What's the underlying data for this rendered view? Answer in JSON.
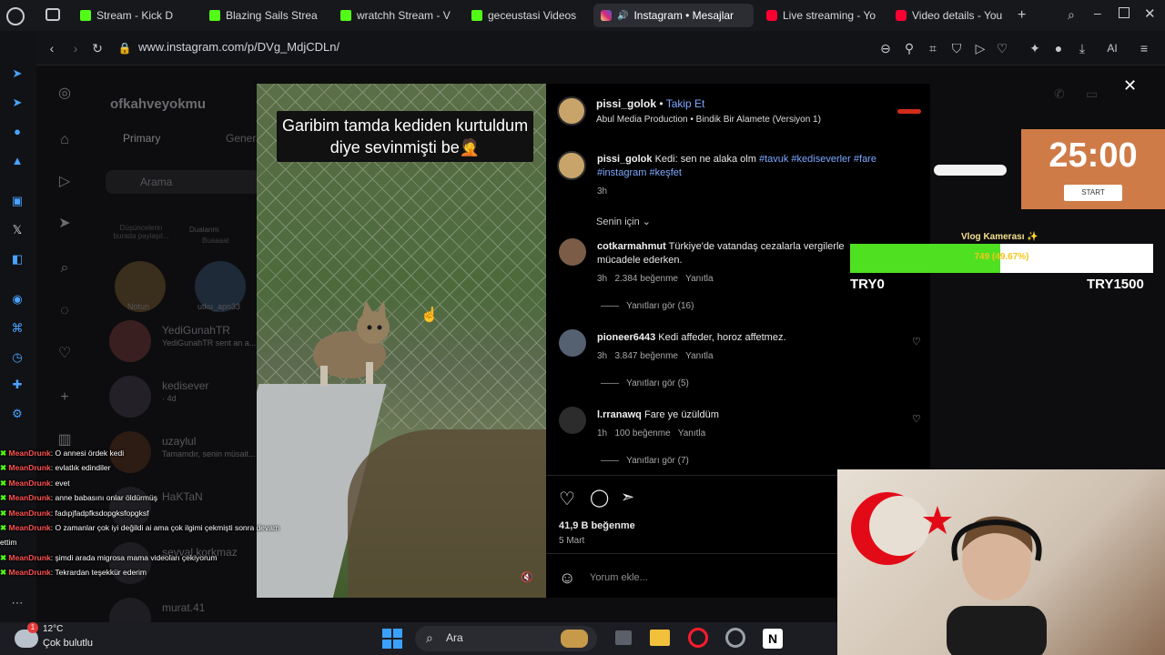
{
  "browser": {
    "tabs": [
      {
        "label": "Stream - Kick D",
        "icon": "kick-icon"
      },
      {
        "label": "Blazing Sails Strea",
        "icon": "kick-icon"
      },
      {
        "label": "wratchh Stream - V",
        "icon": "kick-icon"
      },
      {
        "label": "geceustasi Videos",
        "icon": "kick-icon"
      },
      {
        "label": "Instagram • Mesajlar",
        "icon": "instagram-icon"
      },
      {
        "label": "Live streaming - Yo",
        "icon": "youtube-icon"
      },
      {
        "label": "Video details - You",
        "icon": "youtube-icon"
      }
    ],
    "url": "www.instagram.com/p/DVg_MdjCDLn/",
    "ai_label": "AI"
  },
  "instagram_bg": {
    "username": "ofkahveyokmu",
    "tab_primary": "Primary",
    "tab_general": "Gener",
    "search_placeholder": "Arama",
    "stories": [
      {
        "label": "Notun"
      },
      {
        "label": "utku_apn33"
      }
    ],
    "story_note_1": "Düşüncelerin burada paylaşıl...",
    "story_note_2": "Dualarım",
    "story_note_2b": "Buaaaat",
    "conversations": [
      {
        "name": "YediGunahTR",
        "preview": "YediGunahTR sent an a..."
      },
      {
        "name": "kedisever",
        "preview": "· 4d"
      },
      {
        "name": "uzaylul",
        "preview": "Tamamdır, senin müsait..."
      },
      {
        "name": "HaKTaN",
        "preview": ""
      },
      {
        "name": "şevval korkmaz",
        "preview": ""
      },
      {
        "name": "murat.41",
        "preview": ""
      }
    ]
  },
  "post": {
    "caption_overlay": "Garibim tamda kediden kurtuldum diye sevinmişti be🤦",
    "author": "pissi_golok",
    "follow": "Takip Et",
    "audio": "Abul Media Production • Bindik Bir Alamete (Versiyon 1)",
    "caption_user": "pissi_golok",
    "caption_text": "Kedi: sen ne alaka olm",
    "hashtags_line1": "#tavuk #kediseverler #fare",
    "hashtags_line2": "#instagram #keşfet",
    "caption_time": "3h",
    "for_you": "Senin için",
    "comments": [
      {
        "user": "cotkarmahmut",
        "text_line1": "Türkiye'de vatandaş cezalarla vergilerle",
        "text_line2": "mücadele ederken.",
        "time": "3h",
        "likes": "2.384 beğenme",
        "reply": "Yanıtla",
        "view_replies": "Yanıtları gör (16)"
      },
      {
        "user": "pioneer6443",
        "text_line1": "Kedi affeder, horoz affetmez.",
        "text_line2": "",
        "time": "3h",
        "likes": "3.847 beğenme",
        "reply": "Yanıtla",
        "view_replies": "Yanıtları gör (5)"
      },
      {
        "user": "l.rranawq",
        "text_line1": "Fare ye üzüldüm",
        "text_line2": "",
        "time": "1h",
        "likes": "100 beğenme",
        "reply": "Yanıtla",
        "view_replies": "Yanıtları gör (7)"
      }
    ],
    "likes_total": "41,9 B beğenme",
    "date": "5 Mart",
    "comment_placeholder": "Yorum ekle..."
  },
  "overlay": {
    "timer": "25:00",
    "timer_button": "START",
    "goal_title": "Vlog Kamerası ✨",
    "goal_percent_text": "749 (49.67%)",
    "goal_fraction": 0.4967,
    "goal_min": "TRY0",
    "goal_max": "TRY1500"
  },
  "chat": [
    {
      "user": "MeanDrunk",
      "text": ": O annesi ördek kedi"
    },
    {
      "user": "MeanDrunk",
      "text": ": evlatlık edindiler"
    },
    {
      "user": "MeanDrunk",
      "text": ": evet"
    },
    {
      "user": "MeanDrunk",
      "text": ": anne babasını onlar öldürmüş"
    },
    {
      "user": "MeanDrunk",
      "text": ": fadıpjfadpfksdopgksfopgksf"
    },
    {
      "user": "MeanDrunk",
      "text": ": O zamanlar çok iyi değildi ai ama çok ilgimi çekmişti sonra devam"
    },
    {
      "user": "",
      "text": "ettim"
    },
    {
      "user": "MeanDrunk",
      "text": ": şimdi arada migrosa mama videoları çekiyorum"
    },
    {
      "user": "MeanDrunk",
      "text": ": Tekrardan teşekkür ederim"
    }
  ],
  "taskbar": {
    "weather_temp": "12°C",
    "weather_desc": "Çok bulutlu",
    "search": "Ara",
    "notification_count": "1"
  },
  "colors": {
    "accent_link": "#7da8ff",
    "timer_bg": "#cf7b48",
    "goal_fill": "#4fe021",
    "kick_green": "#53fc18"
  }
}
